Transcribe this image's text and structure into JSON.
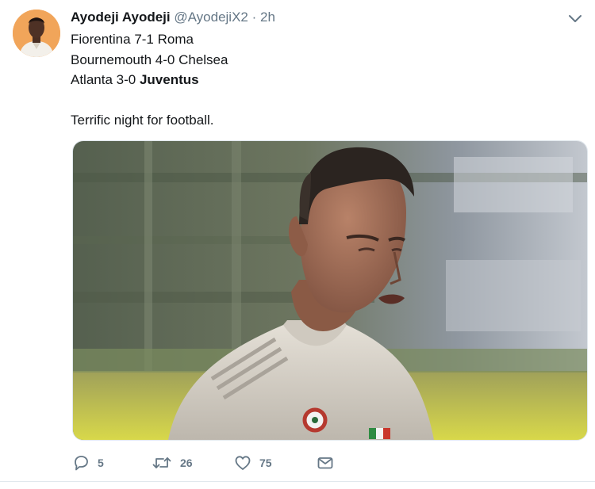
{
  "tweet": {
    "author_name": "Ayodeji Ayodeji",
    "handle": "@AyodejiX2",
    "separator": "·",
    "time": "2h",
    "lines": [
      "Fiorentina 7-1 Roma",
      "Bournemouth 4-0 Chelsea",
      "Atlanta 3-0 "
    ],
    "bold_text": "Juventus",
    "closing_line": "Terrific night for football."
  },
  "actions": {
    "reply_count": "5",
    "retweet_count": "26",
    "like_count": "75"
  },
  "icons": {
    "caret": "chevron-down-icon",
    "reply": "reply-icon",
    "retweet": "retweet-icon",
    "like": "heart-icon",
    "message": "envelope-icon"
  },
  "colors": {
    "text": "#14171a",
    "secondary": "#657786",
    "border": "#e1e8ed"
  }
}
